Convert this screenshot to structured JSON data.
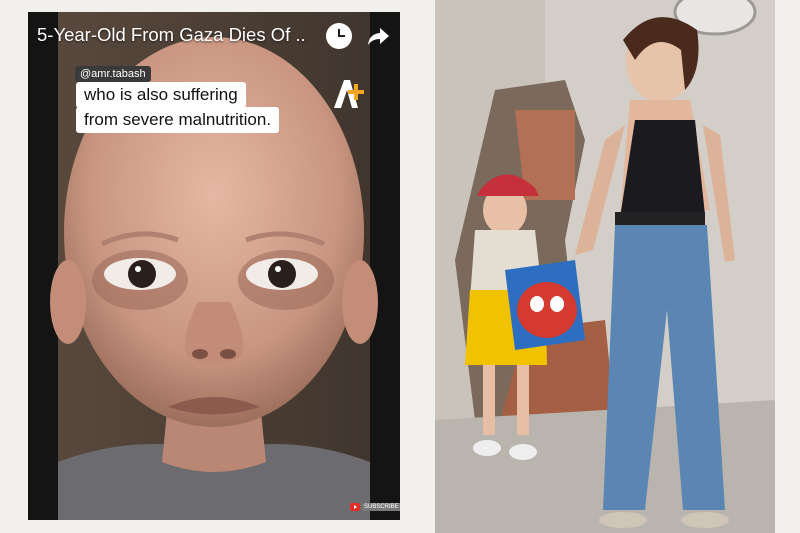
{
  "video": {
    "title": "5-Year-Old From Gaza Dies Of ...",
    "handle": "@amr.tabash",
    "caption_lines": [
      "who is also suffering",
      "from severe malnutrition."
    ],
    "logo_text": "AJ+",
    "subscribe_label": "SUBSCRIBE",
    "icons": [
      "clock-icon",
      "share-arrow-icon",
      "youtube-icon"
    ]
  },
  "photo": {
    "subject": "woman-and-child-photo"
  },
  "colors": {
    "background": "#f1f0ec",
    "video_frame": "#141414",
    "caption_bg": "#ffffff",
    "youtube_red": "#e52d27"
  }
}
